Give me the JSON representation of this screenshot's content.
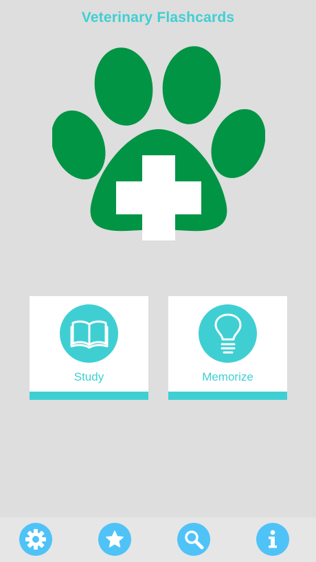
{
  "app": {
    "title": "Veterinary Flashcards"
  },
  "colors": {
    "accent": "#3fcfd3",
    "brand_green": "#009444",
    "tab_icon_bg": "#4fc3f7",
    "background": "#dedede",
    "card_bg": "#ffffff"
  },
  "logo": {
    "icon": "paw-with-medical-cross-icon"
  },
  "menu": {
    "study": {
      "label": "Study",
      "icon": "open-book-icon"
    },
    "memorize": {
      "label": "Memorize",
      "icon": "lightbulb-icon"
    }
  },
  "tabbar": {
    "items": [
      {
        "icon": "gear-icon"
      },
      {
        "icon": "star-icon"
      },
      {
        "icon": "magnifier-icon"
      },
      {
        "icon": "info-icon"
      }
    ]
  }
}
